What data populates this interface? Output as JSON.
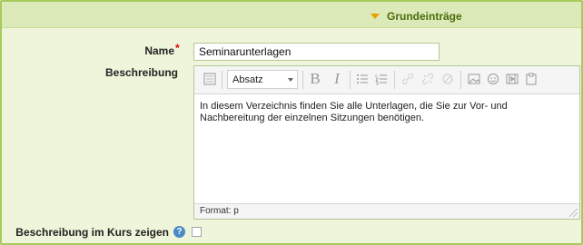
{
  "section": {
    "title": "Grundeinträge"
  },
  "fields": {
    "name_label": "Name",
    "name_required_mark": "*",
    "name_value": "Seminarunterlagen",
    "description_label": "Beschreibung",
    "show_in_course_label": "Beschreibung im Kurs zeigen",
    "help_icon_text": "?"
  },
  "editor": {
    "format_select_value": "Absatz",
    "content_text": "In diesem Verzeichnis finden Sie alle Unterlagen, die Sie zur Vor- und Nachbereitung der einzelnen Sitzungen benötigen.",
    "path_text": "Format: p",
    "toolbar_icons": [
      "toggle-icon",
      "bold-icon",
      "italic-icon",
      "bullet-list-icon",
      "number-list-icon",
      "link-icon",
      "unlink-icon",
      "nolink-icon",
      "image-icon",
      "emoticon-icon",
      "media-icon",
      "paste-icon"
    ],
    "bold_glyph": "B",
    "italic_glyph": "I"
  },
  "colors": {
    "background": "#eef5da",
    "header": "#dce9b8",
    "accent": "#a8c95b",
    "required": "#dd0000",
    "help": "#4a89c8"
  }
}
